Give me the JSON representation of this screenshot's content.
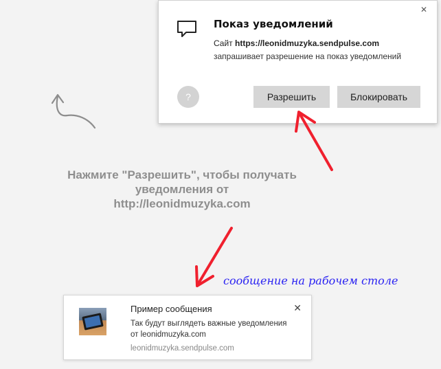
{
  "popup": {
    "title": "Показ уведомлений",
    "site_prefix": "Сайт",
    "site_url": "https://leonidmuzyka.sendpulse.com",
    "request_text": "запрашивает разрешение на показ уведомлений",
    "close_glyph": "✕",
    "help_glyph": "?",
    "allow_label": "Разрешить",
    "block_label": "Блокировать"
  },
  "instructions": {
    "line1": "Нажмите \"Разрешить\", чтобы получать",
    "line2": "уведомления от",
    "line3": "http://leonidmuzyka.com"
  },
  "desktop_label": "сообщение на рабочем столе",
  "notification": {
    "title": "Пример сообщения",
    "body": "Так будут выглядеть важные уведомления от leonidmuzyka.com",
    "domain": "leonidmuzyka.sendpulse.com",
    "close_glyph": "✕"
  },
  "colors": {
    "arrow_red": "#f0202e",
    "desktop_label_blue": "#2b23f2",
    "button_gray": "#d6d6d6"
  },
  "icons": [
    "message-icon",
    "help-icon",
    "curly-arrow-icon",
    "red-arrow-icon",
    "tablet-thumbnail-icon",
    "close-icon"
  ]
}
